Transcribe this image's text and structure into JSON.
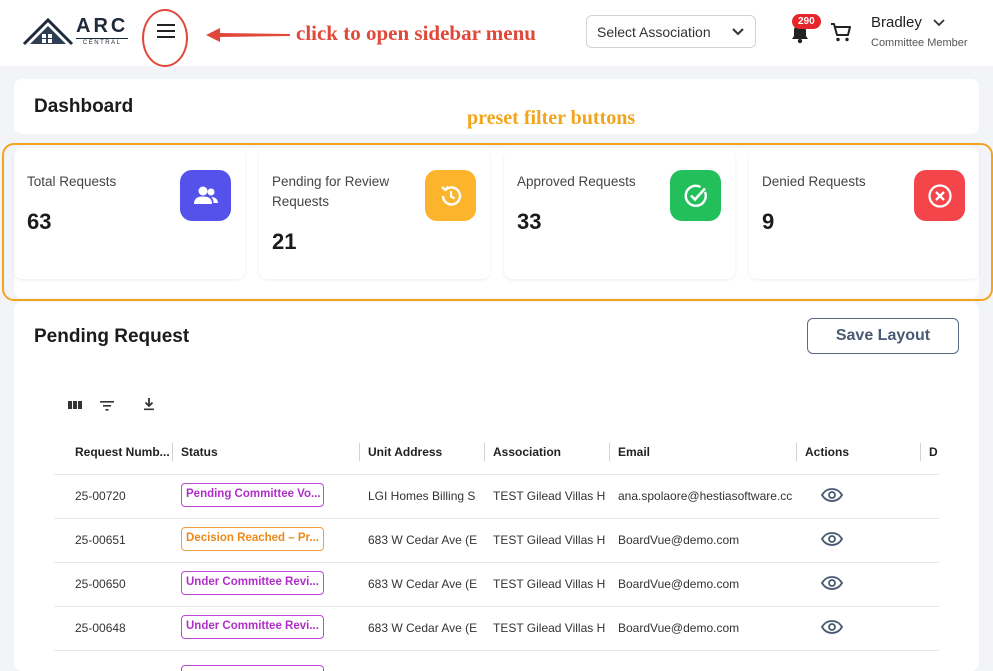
{
  "header": {
    "logo_text": "ARC",
    "logo_subtext": "CENTRAL",
    "annotation_sidebar": "click to open sidebar menu",
    "association_select": {
      "value": "Select Association"
    },
    "notification_count": "290",
    "user": {
      "name": "Bradley",
      "role": "Committee Member"
    }
  },
  "dashboard": {
    "title": "Dashboard",
    "annotation_filters": "preset filter buttons"
  },
  "stats": [
    {
      "label": "Total Requests",
      "value": "63",
      "icon": "users-icon",
      "color": "#5452ea"
    },
    {
      "label": "Pending for Review Requests",
      "value": "21",
      "icon": "history-icon",
      "color": "#fbb42c"
    },
    {
      "label": "Approved Requests",
      "value": "33",
      "icon": "check-circle-icon",
      "color": "#22bf5b"
    },
    {
      "label": "Denied Requests",
      "value": "9",
      "icon": "x-circle-icon",
      "color": "#f4454b"
    }
  ],
  "pending": {
    "title": "Pending Request",
    "save_label": "Save Layout",
    "columns": [
      "Request Numb...",
      "Status",
      "Unit Address",
      "Association",
      "Email",
      "Actions",
      "D"
    ],
    "rows": [
      {
        "number": "25-00720",
        "status": "Pending Committee Vo...",
        "status_color": "purple",
        "address": "LGI Homes Billing S",
        "association": "TEST Gilead Villas H",
        "email": "ana.spolaore@hestiasoftware.cc"
      },
      {
        "number": "25-00651",
        "status": "Decision Reached – Pr...",
        "status_color": "orange",
        "address": "683 W Cedar Ave (E",
        "association": "TEST Gilead Villas H",
        "email": "BoardVue@demo.com"
      },
      {
        "number": "25-00650",
        "status": "Under Committee Revi...",
        "status_color": "purple",
        "address": "683 W Cedar Ave (E",
        "association": "TEST Gilead Villas H",
        "email": "BoardVue@demo.com"
      },
      {
        "number": "25-00648",
        "status": "Under Committee Revi...",
        "status_color": "purple",
        "address": "683 W Cedar Ave (E",
        "association": "TEST Gilead Villas H",
        "email": "BoardVue@demo.com"
      }
    ]
  }
}
